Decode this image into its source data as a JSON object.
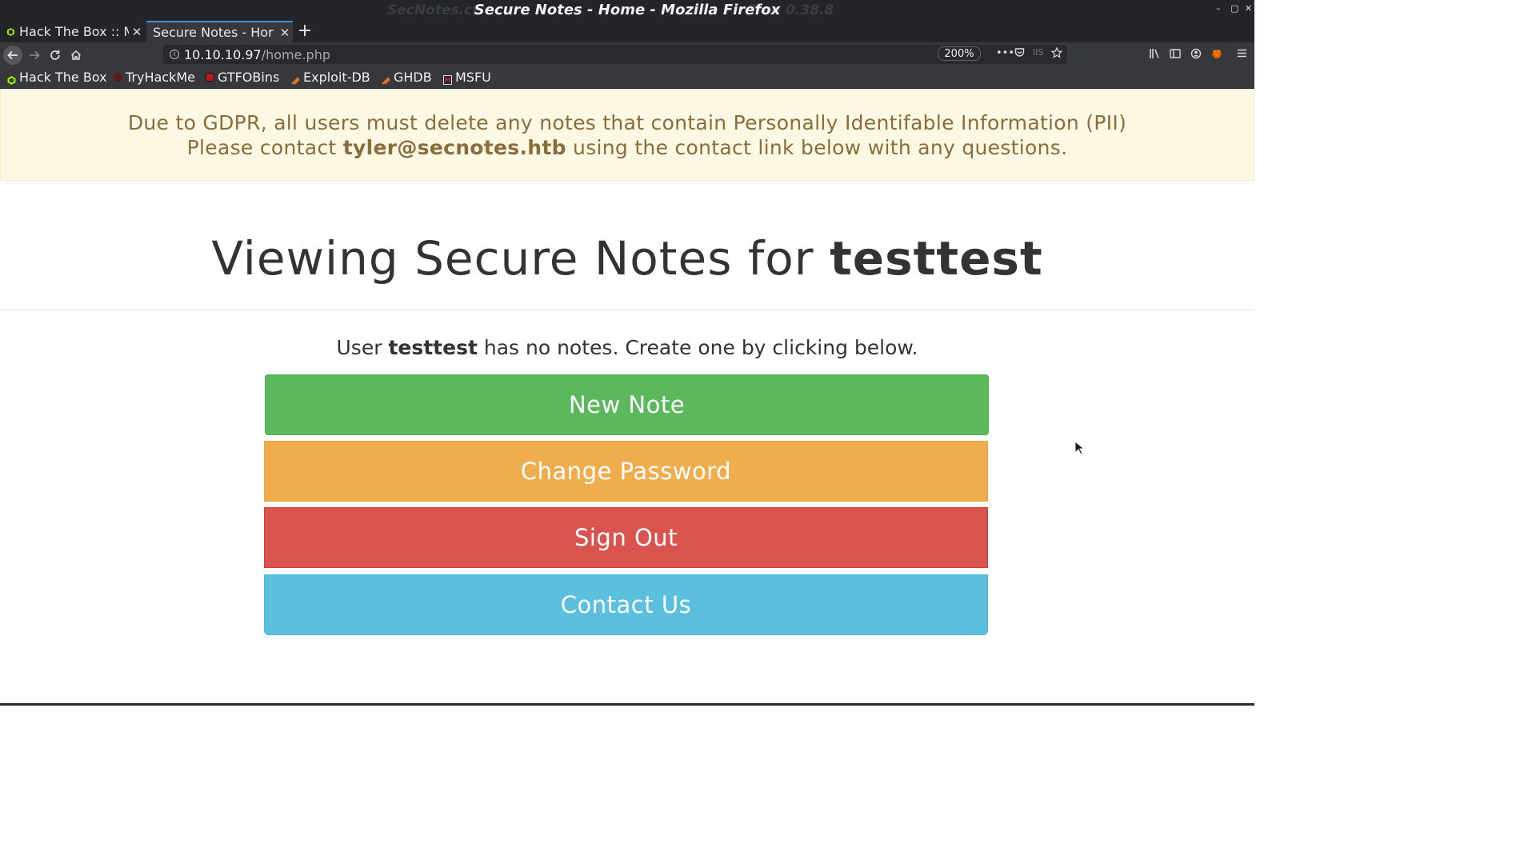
{
  "window": {
    "title": "Secure Notes - Home - Mozilla Firefox",
    "bg_left": "SecNotes.ct",
    "bg_right": "Tree 0.38.8",
    "controls": [
      "–",
      "▢",
      "✕"
    ]
  },
  "tabs": [
    {
      "label": "Hack The Box :: M",
      "icon": "htb-icon",
      "active": false
    },
    {
      "label": "Secure Notes - Hor",
      "icon": "",
      "active": true
    }
  ],
  "newtab_label": "+",
  "navbar": {
    "url_host": "10.10.10.97",
    "url_path": "/home.php",
    "zoom": "200%"
  },
  "bookmarks": [
    {
      "label": "Hack The Box",
      "icon": "htb-icon",
      "color": "#9fef00"
    },
    {
      "label": "TryHackMe",
      "icon": "tryhackme-icon",
      "color": "#c11111"
    },
    {
      "label": "GTFOBins",
      "icon": "gtfobins-icon",
      "color": "#b71c1c"
    },
    {
      "label": "Exploit-DB",
      "icon": "exploit-db-icon",
      "color": "#ec6f2a"
    },
    {
      "label": "GHDB",
      "icon": "ghdb-icon",
      "color": "#ec6f2a"
    },
    {
      "label": "MSFU",
      "icon": "msfu-icon",
      "color": "#d9d9d9"
    }
  ],
  "alert": {
    "line1": "Due to GDPR, all users must delete any notes that contain Personally Identifable Information (PII)",
    "line2_prefix": "Please contact ",
    "line2_email": "tyler@secnotes.htb",
    "line2_suffix": " using the contact link below with any questions."
  },
  "heading": {
    "prefix": "Viewing Secure Notes for ",
    "username": "testtest"
  },
  "message": {
    "prefix": "User ",
    "username": "testtest",
    "suffix": " has no notes. Create one by clicking below."
  },
  "buttons": {
    "new_note": "New Note",
    "change_password": "Change Password",
    "sign_out": "Sign Out",
    "contact_us": "Contact Us"
  },
  "colors": {
    "success": "#5cb85c",
    "warning": "#f0ad4e",
    "danger": "#d9534f",
    "info": "#5bc0de",
    "alert_bg": "#fcf8e3",
    "alert_text": "#8a6d3b"
  }
}
